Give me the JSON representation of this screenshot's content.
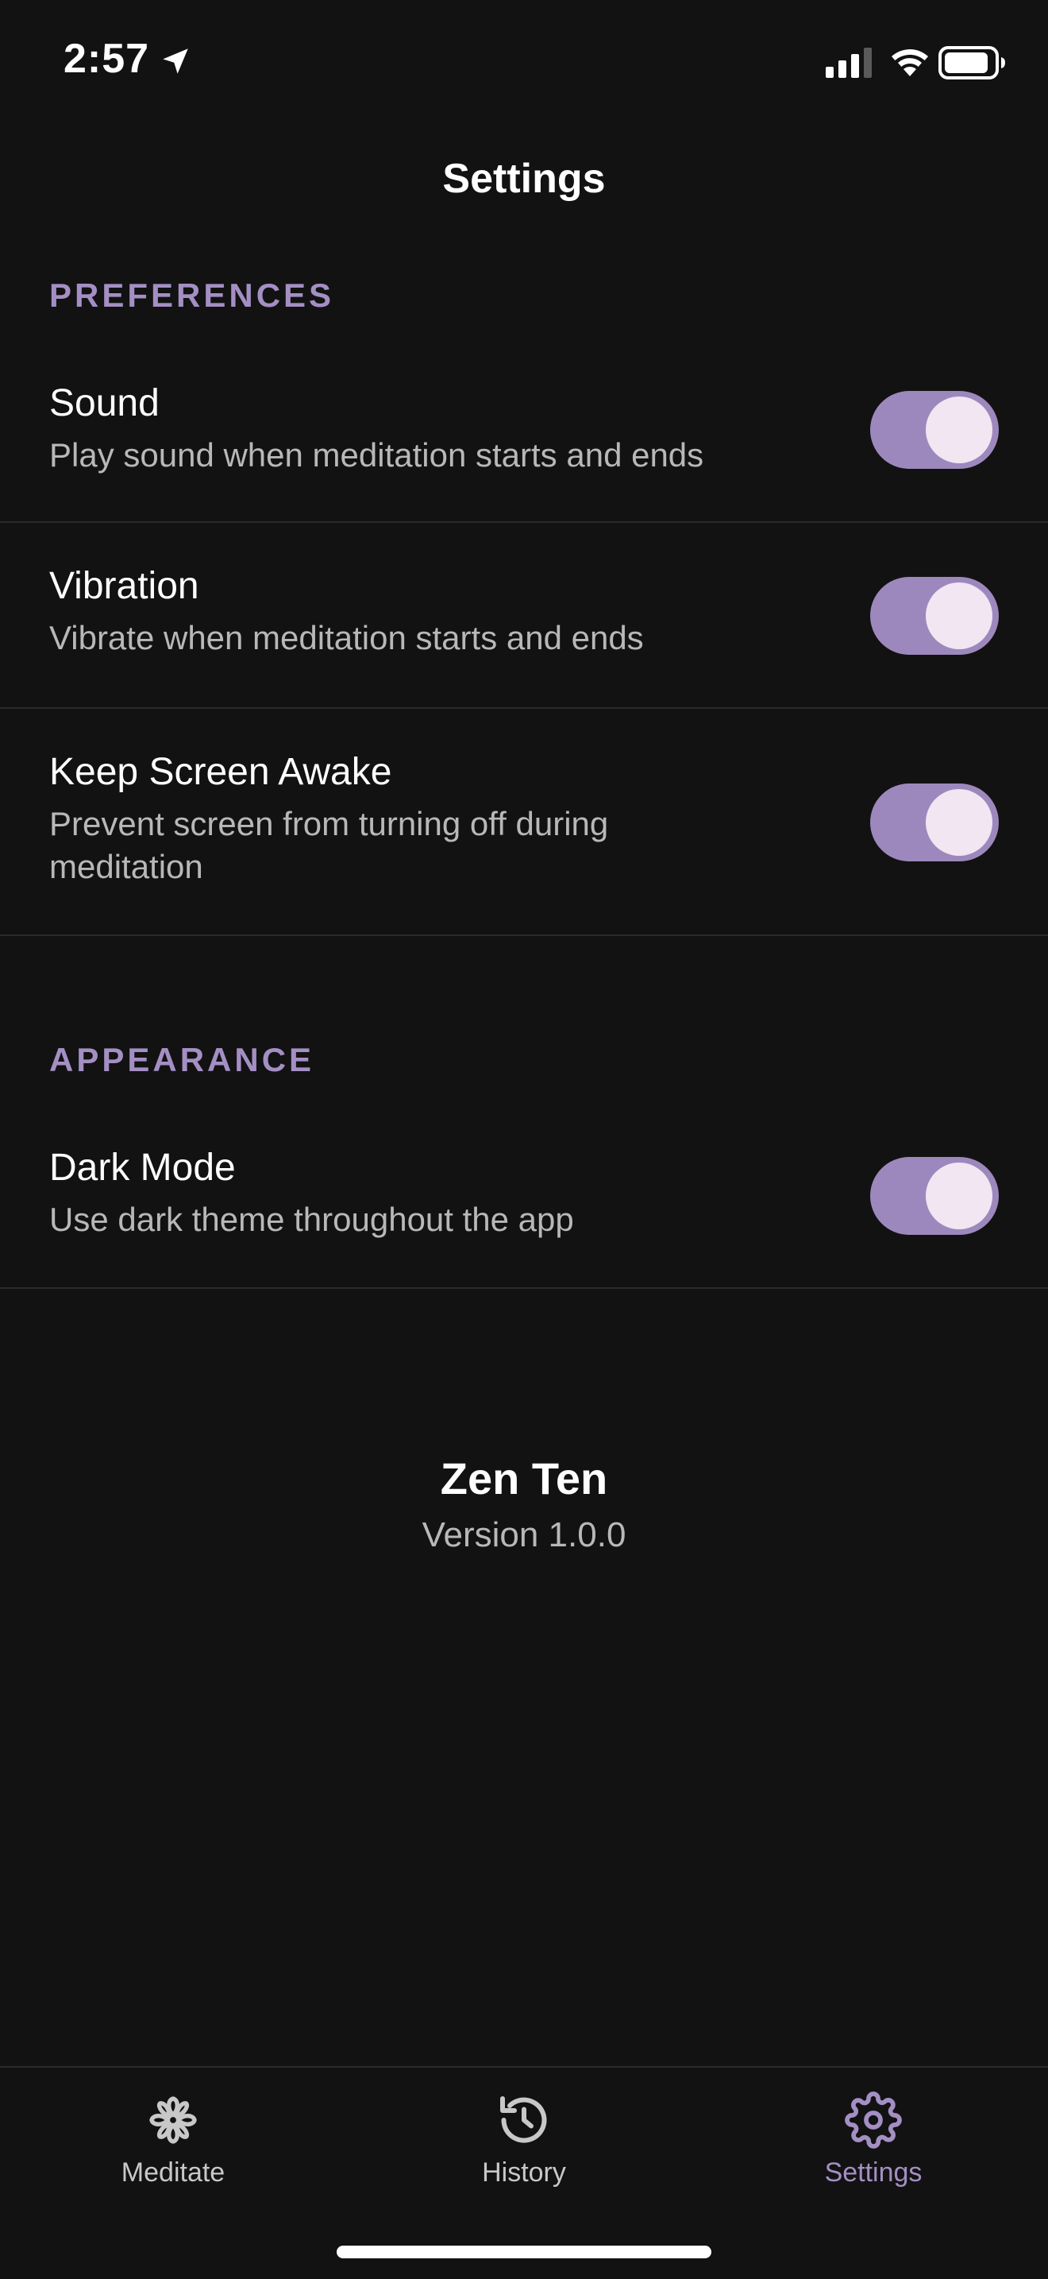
{
  "status_bar": {
    "time": "2:57"
  },
  "header": {
    "title": "Settings"
  },
  "preferences": {
    "section_label": "PREFERENCES",
    "items": [
      {
        "title": "Sound",
        "description": "Play sound when meditation starts and ends",
        "enabled": true
      },
      {
        "title": "Vibration",
        "description": "Vibrate when meditation starts and ends",
        "enabled": true
      },
      {
        "title": "Keep Screen Awake",
        "description": "Prevent screen from turning off during meditation",
        "enabled": true
      }
    ]
  },
  "appearance": {
    "section_label": "APPEARANCE",
    "items": [
      {
        "title": "Dark Mode",
        "description": "Use dark theme throughout the app",
        "enabled": true
      }
    ]
  },
  "about": {
    "app_name": "Zen Ten",
    "version": "Version 1.0.0"
  },
  "tab_bar": {
    "tabs": [
      {
        "label": "Meditate",
        "icon": "flower-icon",
        "active": false
      },
      {
        "label": "History",
        "icon": "history-icon",
        "active": false
      },
      {
        "label": "Settings",
        "icon": "gear-icon",
        "active": true
      }
    ]
  },
  "colors": {
    "background": "#121212",
    "accent": "#a48fc4",
    "toggle_track": "#9d88bd",
    "toggle_knob": "#f1e6f2",
    "divider": "#2a2a2a"
  }
}
